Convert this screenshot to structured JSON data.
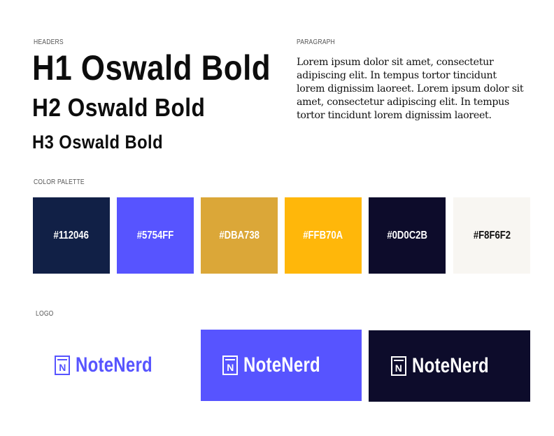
{
  "sections": {
    "headers_label": "HEADERS",
    "paragraph_label": "PARAGRAPH",
    "palette_label": "COLOR PALETTE",
    "logo_label": "LOGO"
  },
  "headers": {
    "h1": "H1 Oswald Bold",
    "h2": "H2 Oswald Bold",
    "h3": "H3 Oswald Bold"
  },
  "paragraph": {
    "text": "Lorem ipsum dolor sit amet, consectetur adipiscing elit. In tempus tortor tincidunt lorem dignissim laoreet. Lorem ipsum dolor sit amet, consectetur adipiscing elit. In tempus tortor tincidunt lorem dignissim laoreet."
  },
  "palette": [
    {
      "label": "#112046",
      "color": "#112046",
      "text_color": "#ffffff"
    },
    {
      "label": "#5754FF",
      "color": "#5754FF",
      "text_color": "#ffffff"
    },
    {
      "label": "#DBA738",
      "color": "#DBA738",
      "text_color": "#ffffff"
    },
    {
      "label": "#FFB70A",
      "color": "#FFB70A",
      "text_color": "#ffffff"
    },
    {
      "label": "#0D0C2B",
      "color": "#0D0C2B",
      "text_color": "#ffffff"
    },
    {
      "label": "#F8F6F2",
      "color": "#F8F6F2",
      "text_color": "#111111"
    }
  ],
  "logos": [
    {
      "mark": "N",
      "name": "NoteNerd",
      "background": "#ffffff",
      "foreground": "#5754FF"
    },
    {
      "mark": "N",
      "name": "NoteNerd",
      "background": "#5754FF",
      "foreground": "#ffffff"
    },
    {
      "mark": "N",
      "name": "NoteNerd",
      "background": "#0D0C2B",
      "foreground": "#ffffff"
    }
  ]
}
